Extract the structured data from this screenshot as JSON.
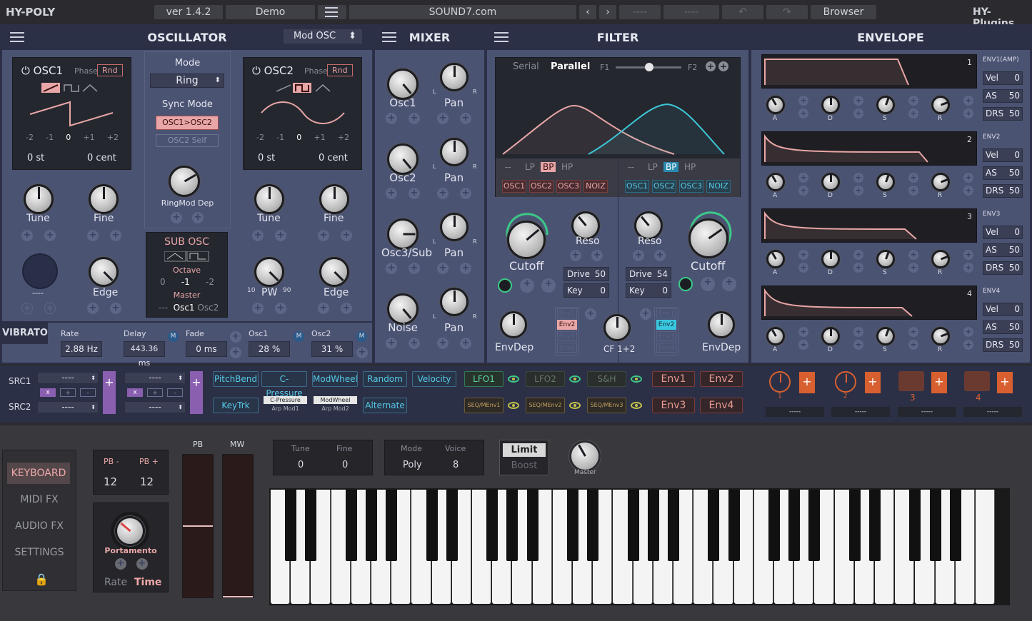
{
  "topbar": {
    "app": "HY-POLY",
    "version": "ver 1.4.2",
    "preset": "Demo",
    "site": "SOUND7.com",
    "slot1": "----",
    "slot2": "----",
    "browser": "Browser",
    "brand": "HY-Plugins"
  },
  "osc": {
    "title": "OSCILLATOR",
    "mod": "Mod OSC",
    "osc1": "OSC1",
    "osc2": "OSC2",
    "phase": "Phase",
    "rnd": "Rnd",
    "ticks": [
      "-2",
      "-1",
      "0",
      "+1",
      "+2"
    ],
    "st": "0 st",
    "cent": "0 cent",
    "mode_lbl": "Mode",
    "mode": "Ring",
    "sync_lbl": "Sync Mode",
    "sync1": "OSC1>OSC2",
    "sync2": "OSC2 Self",
    "ringmod": "RingMod Dep",
    "tune": "Tune",
    "fine": "Fine",
    "edge": "Edge",
    "pw": "PW",
    "pw_lo": "10",
    "pw_hi": "90",
    "dash": "----",
    "sub": "SUB OSC",
    "octave": "Octave",
    "oct_vals": [
      "0",
      "-1",
      "-2"
    ],
    "master": "Master",
    "master_dash": "---",
    "m1": "Osc1",
    "m2": "Osc2"
  },
  "vibrato": {
    "title": "VIBRATO",
    "rate": "Rate",
    "rate_v": "2.88 Hz",
    "delay": "Delay",
    "delay_v": "443.36 ms",
    "fade": "Fade",
    "fade_v": "0 ms",
    "osc1": "Osc1",
    "osc1_v": "28 %",
    "osc2": "Osc2",
    "osc2_v": "31 %",
    "m": "M"
  },
  "mixer": {
    "title": "MIXER",
    "rows": [
      "Osc1",
      "Osc2",
      "Osc3/Sub",
      "Noise"
    ],
    "pan": "Pan"
  },
  "filter": {
    "title": "FILTER",
    "serial": "Serial",
    "parallel": "Parallel",
    "f1": "F1",
    "f2": "F2",
    "types": [
      "--",
      "LP",
      "BP",
      "HP"
    ],
    "srcs": [
      "OSC1",
      "OSC2",
      "OSC3",
      "NOIZ"
    ],
    "cutoff": "Cutoff",
    "reso": "Reso",
    "drive": "Drive",
    "drive1": "50",
    "drive2": "54",
    "key": "Key",
    "key_v": "0",
    "envdep": "EnvDep",
    "cf": "CF 1+2",
    "envs": [
      "Env1",
      "Env2",
      "Env3",
      "Env4"
    ]
  },
  "envelope": {
    "title": "ENVELOPE",
    "rows": [
      {
        "n": "1",
        "name": "ENV1(AMP)"
      },
      {
        "n": "2",
        "name": "ENV2"
      },
      {
        "n": "3",
        "name": "ENV3"
      },
      {
        "n": "4",
        "name": "ENV4"
      }
    ],
    "adsr": [
      "A",
      "D",
      "S",
      "R"
    ],
    "vel": "Vel",
    "vel_v": "0",
    "as": "AS",
    "as_v": "50",
    "drs": "DRS",
    "drs_v": "50"
  },
  "mod": {
    "src1": "SRC1",
    "src2": "SRC2",
    "dash": "----",
    "ops": [
      "x",
      "+",
      "-"
    ],
    "blue": [
      "PitchBend",
      "C-Pressure",
      "ModWheel",
      "Random",
      "Velocity"
    ],
    "blue2": [
      "KeyTrk",
      "Alternate"
    ],
    "mini1": "C-Pressure",
    "mini1s": "Arp Mod1",
    "mini2": "ModWheel",
    "mini2s": "Arp Mod2",
    "lfo": [
      "LFO1",
      "LFO2",
      "S&H"
    ],
    "seq": [
      "SEQ/MEnv1",
      "SEQ/MEnv2",
      "SEQ/MEnv3"
    ],
    "env": [
      "Env1",
      "Env2",
      "Env3",
      "Env4"
    ],
    "macros": [
      "1",
      "2",
      "3",
      "4"
    ],
    "macro_dash": "-----"
  },
  "keyboard": {
    "tabs": [
      "KEYBOARD",
      "MIDI FX",
      "AUDIO FX",
      "SETTINGS"
    ],
    "pbm": "PB -",
    "pbp": "PB +",
    "pbm_v": "12",
    "pbp_v": "12",
    "porta": "Portamento",
    "rate": "Rate",
    "time": "Time",
    "pb": "PB",
    "mw": "MW",
    "tune": "Tune",
    "fine": "Fine",
    "tune_v": "0",
    "fine_v": "0",
    "mode": "Mode",
    "voice": "Voice",
    "mode_v": "Poly",
    "voice_v": "8",
    "limit": "Limit",
    "boost": "Boost",
    "master": "Master"
  },
  "colors": {
    "panel": "#4b5373",
    "accent_red": "#e8a6a6",
    "accent_blue": "#58c8e8",
    "accent_green": "#5ed69a"
  }
}
